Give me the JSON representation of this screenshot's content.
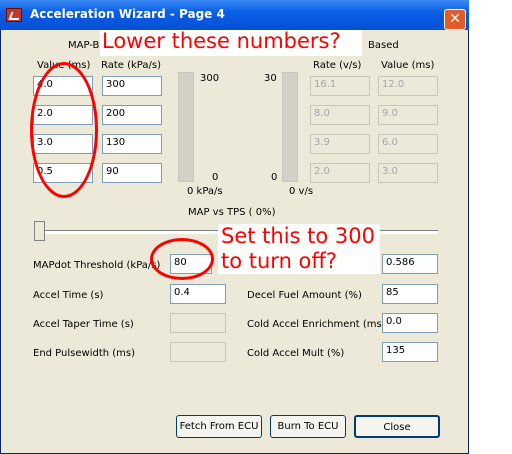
{
  "window": {
    "title": "Acceleration Wizard - Page 4"
  },
  "map_group": {
    "header_partial": "MAP-B",
    "value_header": "Value (ms)",
    "rate_header": "Rate (kPa/s)",
    "values": [
      "4.0",
      "2.0",
      "3.0",
      "0.5"
    ],
    "rates": [
      "300",
      "200",
      "130",
      "90"
    ],
    "bar_max": "300",
    "bar_min": "0",
    "bar_readout": "0 kPa/s"
  },
  "tps_group": {
    "header_partial": "Based",
    "rate_header": "Rate (v/s)",
    "value_header": "Value (ms)",
    "rates": [
      "16.1",
      "8.0",
      "3.9",
      "2.0"
    ],
    "values": [
      "12.0",
      "9.0",
      "6.0",
      "3.0"
    ],
    "bar_max": "30",
    "bar_min": "0",
    "bar_readout": "0 v/s"
  },
  "slider": {
    "label": "MAP vs TPS ( 0%)",
    "percent": 0
  },
  "fields": {
    "mapdot_label": "MAPdot Threshold (kPa/s)",
    "mapdot_value": "80",
    "tps_threshold_value": "0.586",
    "accel_time_label": "Accel Time (s)",
    "accel_time_value": "0.4",
    "decel_fuel_label": "Decel Fuel Amount (%)",
    "decel_fuel_value": "85",
    "accel_taper_label": "Accel Taper Time (s)",
    "accel_taper_value": "",
    "cold_enrich_label": "Cold Accel Enrichment (ms)",
    "cold_enrich_value": "0.0",
    "end_pw_label": "End Pulsewidth (ms)",
    "end_pw_value": "",
    "cold_mult_label": "Cold Accel Mult (%)",
    "cold_mult_value": "135"
  },
  "buttons": {
    "fetch": "Fetch From ECU",
    "burn": "Burn To ECU",
    "close": "Close"
  },
  "annotations": {
    "lower_numbers": "Lower these numbers?",
    "set_300_line1": "Set this to 300",
    "set_300_line2": "to turn off?",
    "color": "#ff0000"
  }
}
